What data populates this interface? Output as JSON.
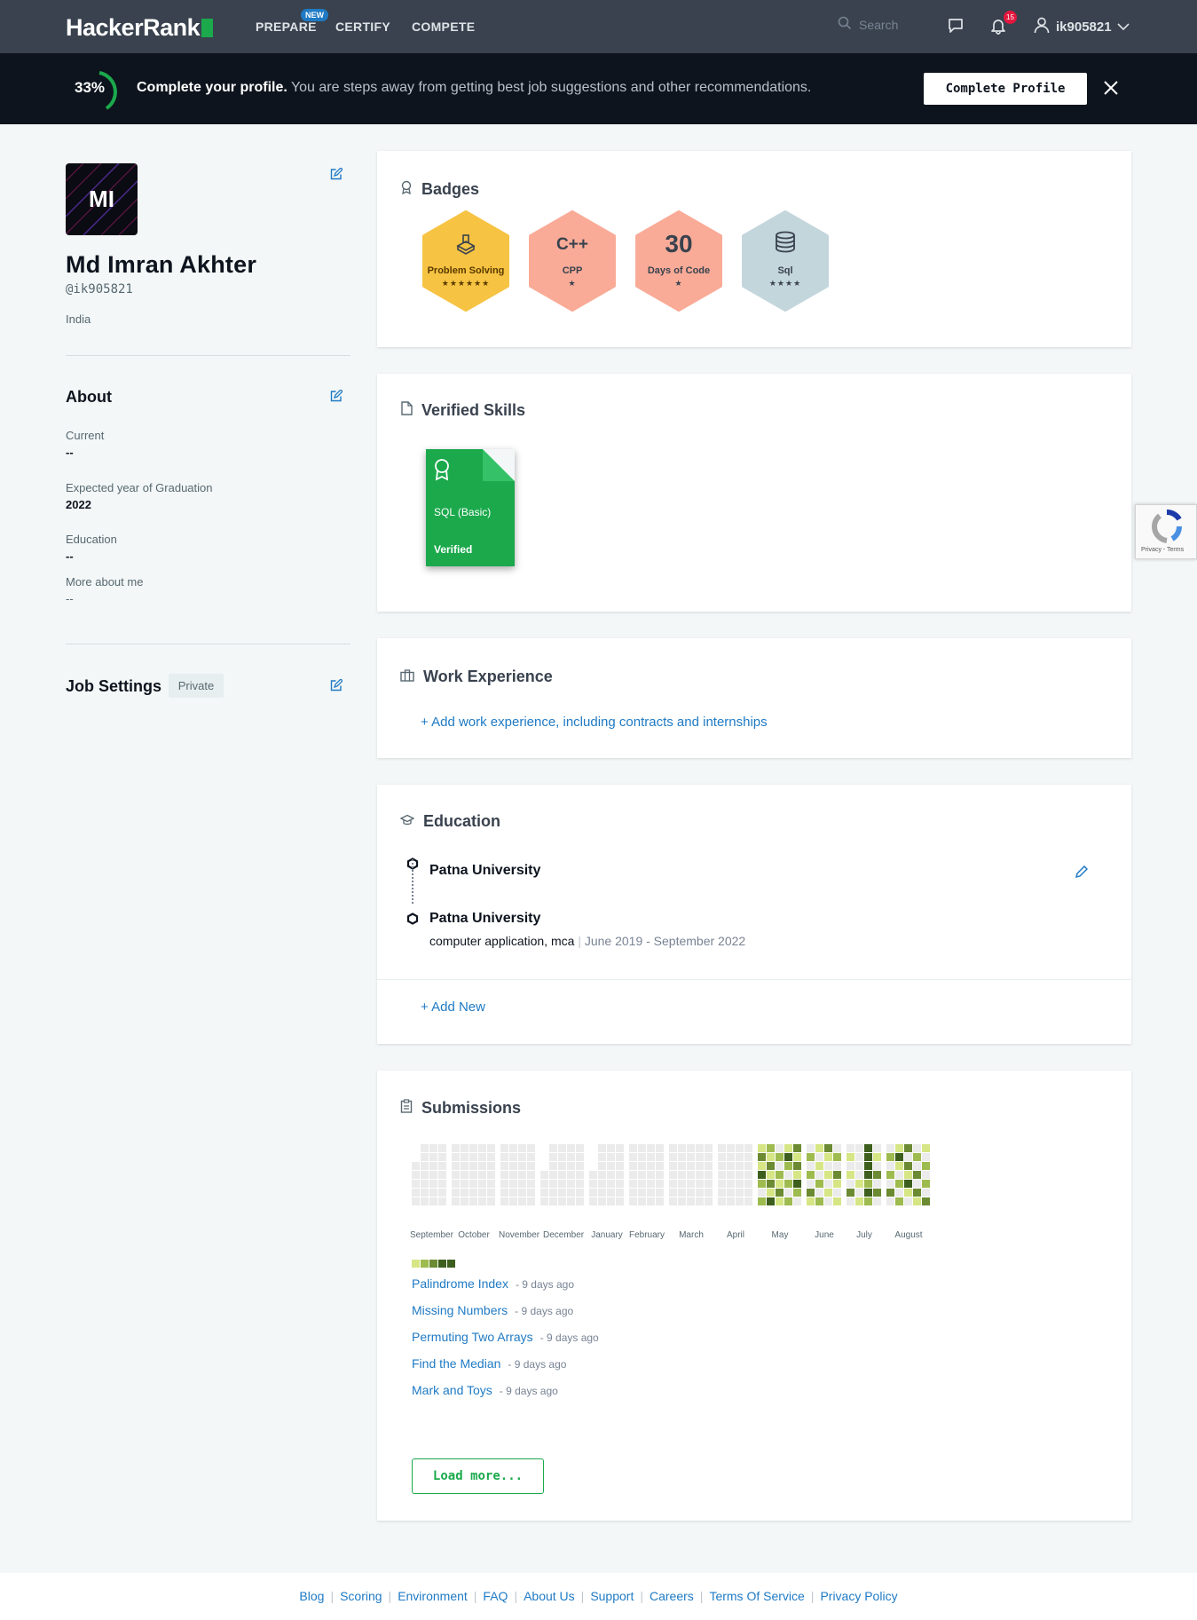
{
  "nav": {
    "logo": "HackerRank",
    "prepare": "PREPARE",
    "new_badge": "NEW",
    "certify": "CERTIFY",
    "compete": "COMPETE",
    "search_placeholder": "Search",
    "notification_count": "15",
    "username": "ik905821"
  },
  "promo": {
    "percent": "33%",
    "percent_value": 33,
    "title": "Complete your profile.",
    "message": "You are steps away from getting best job suggestions and other recommendations.",
    "button": "Complete Profile"
  },
  "profile": {
    "initials": "MI",
    "name": "Md Imran Akhter",
    "handle": "@ik905821",
    "country": "India"
  },
  "about": {
    "title": "About",
    "current_label": "Current",
    "current_value": "--",
    "graduation_label": "Expected year of Graduation",
    "graduation_value": "2022",
    "education_label": "Education",
    "education_value": "--",
    "more_label": "More about me",
    "more_value": "--"
  },
  "job_settings": {
    "title": "Job Settings",
    "visibility": "Private"
  },
  "badges": {
    "title": "Badges",
    "items": [
      {
        "label": "Problem Solving",
        "stars": "★★★★★★",
        "icon": "terminal-icon",
        "text": "",
        "color": "#f6c343"
      },
      {
        "label": "CPP",
        "stars": "★",
        "icon": "cpp-icon",
        "text": "C++",
        "color": "#f8a590"
      },
      {
        "label": "Days of Code",
        "stars": "★",
        "icon": "thirty-days-icon",
        "text": "30",
        "color": "#f8a590"
      },
      {
        "label": "Sql",
        "stars": "★★★★",
        "icon": "database-icon",
        "text": "",
        "color": "#bfd3d9"
      }
    ]
  },
  "verified_skills": {
    "title": "Verified Skills",
    "skill": "SQL (Basic)",
    "status": "Verified"
  },
  "work": {
    "title": "Work Experience",
    "add_link": "+ Add work experience, including contracts and internships"
  },
  "education": {
    "title": "Education",
    "entries": [
      {
        "school": "Patna University",
        "degree": "",
        "dates": ""
      },
      {
        "school": "Patna University",
        "degree": "computer application, mca",
        "dates": "June 2019 - September 2022"
      }
    ],
    "add_new": "+ Add New"
  },
  "submissions": {
    "title": "Submissions",
    "months": [
      "September",
      "October",
      "November",
      "December",
      "January",
      "February",
      "March",
      "April",
      "May",
      "June",
      "July",
      "August"
    ],
    "items": [
      {
        "name": "Palindrome Index",
        "ago": "- 9 days ago"
      },
      {
        "name": "Missing Numbers",
        "ago": "- 9 days ago"
      },
      {
        "name": "Permuting Two Arrays",
        "ago": "- 9 days ago"
      },
      {
        "name": "Find the Median",
        "ago": "- 9 days ago"
      },
      {
        "name": "Mark and Toys",
        "ago": "- 9 days ago"
      }
    ],
    "load_more": "Load more...",
    "colors": {
      "empty": "#ebebeb",
      "l1": "#d6e685",
      "l2": "#9ebb4f",
      "l3": "#6b8a32",
      "l4": "#3d5e1c"
    }
  },
  "footer": {
    "links": [
      "Blog",
      "Scoring",
      "Environment",
      "FAQ",
      "About Us",
      "Support",
      "Careers",
      "Terms Of Service",
      "Privacy Policy"
    ]
  },
  "recaptcha": {
    "text": "Privacy - Terms"
  }
}
